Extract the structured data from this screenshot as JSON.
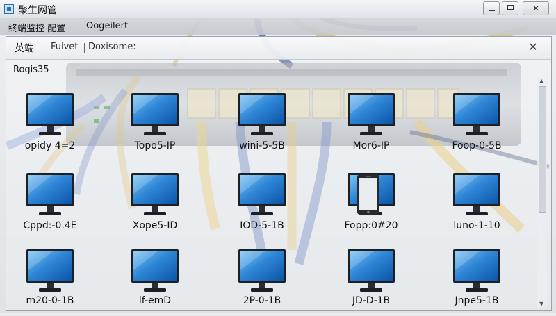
{
  "window": {
    "title": "聚生网管"
  },
  "menu": {
    "item1": "终端监控 配置",
    "item2": "Oogeilert"
  },
  "panel": {
    "title": "英端",
    "tab1": "Fuivet",
    "tab2": "Doxisome:",
    "group_label": "Rogis35"
  },
  "devices": [
    {
      "label": "opidy 4=2",
      "icon": "monitor-icon"
    },
    {
      "label": "Topo5-IP",
      "icon": "monitor-icon"
    },
    {
      "label": "wini-5-5B",
      "icon": "monitor-icon"
    },
    {
      "label": "Mor6-IP",
      "icon": "monitor-icon"
    },
    {
      "label": "Foop-0-5B",
      "icon": "monitor-icon"
    },
    {
      "label": "Cppd:-0.4E",
      "icon": "monitor-icon"
    },
    {
      "label": "Xope5-ID",
      "icon": "monitor-icon"
    },
    {
      "label": "IOD-5-1B",
      "icon": "monitor-icon"
    },
    {
      "label": "Fopp:0#20",
      "icon": "phone-icon"
    },
    {
      "label": "luno-1-10",
      "icon": "monitor-icon"
    },
    {
      "label": "m20-0-1B",
      "icon": "monitor-icon"
    },
    {
      "label": "lf-emD",
      "icon": "monitor-icon"
    },
    {
      "label": "2P-0-1B",
      "icon": "monitor-icon"
    },
    {
      "label": "JD-D-1B",
      "icon": "monitor-icon"
    },
    {
      "label": "Jnpe5-1B",
      "icon": "monitor-icon"
    }
  ],
  "colors": {
    "screen_light": "#6ab6ee",
    "screen_dark": "#0b55a8",
    "bezel": "#1c1f24",
    "cable_yellow": "#e7c26a",
    "cable_blue": "#5573b8"
  }
}
